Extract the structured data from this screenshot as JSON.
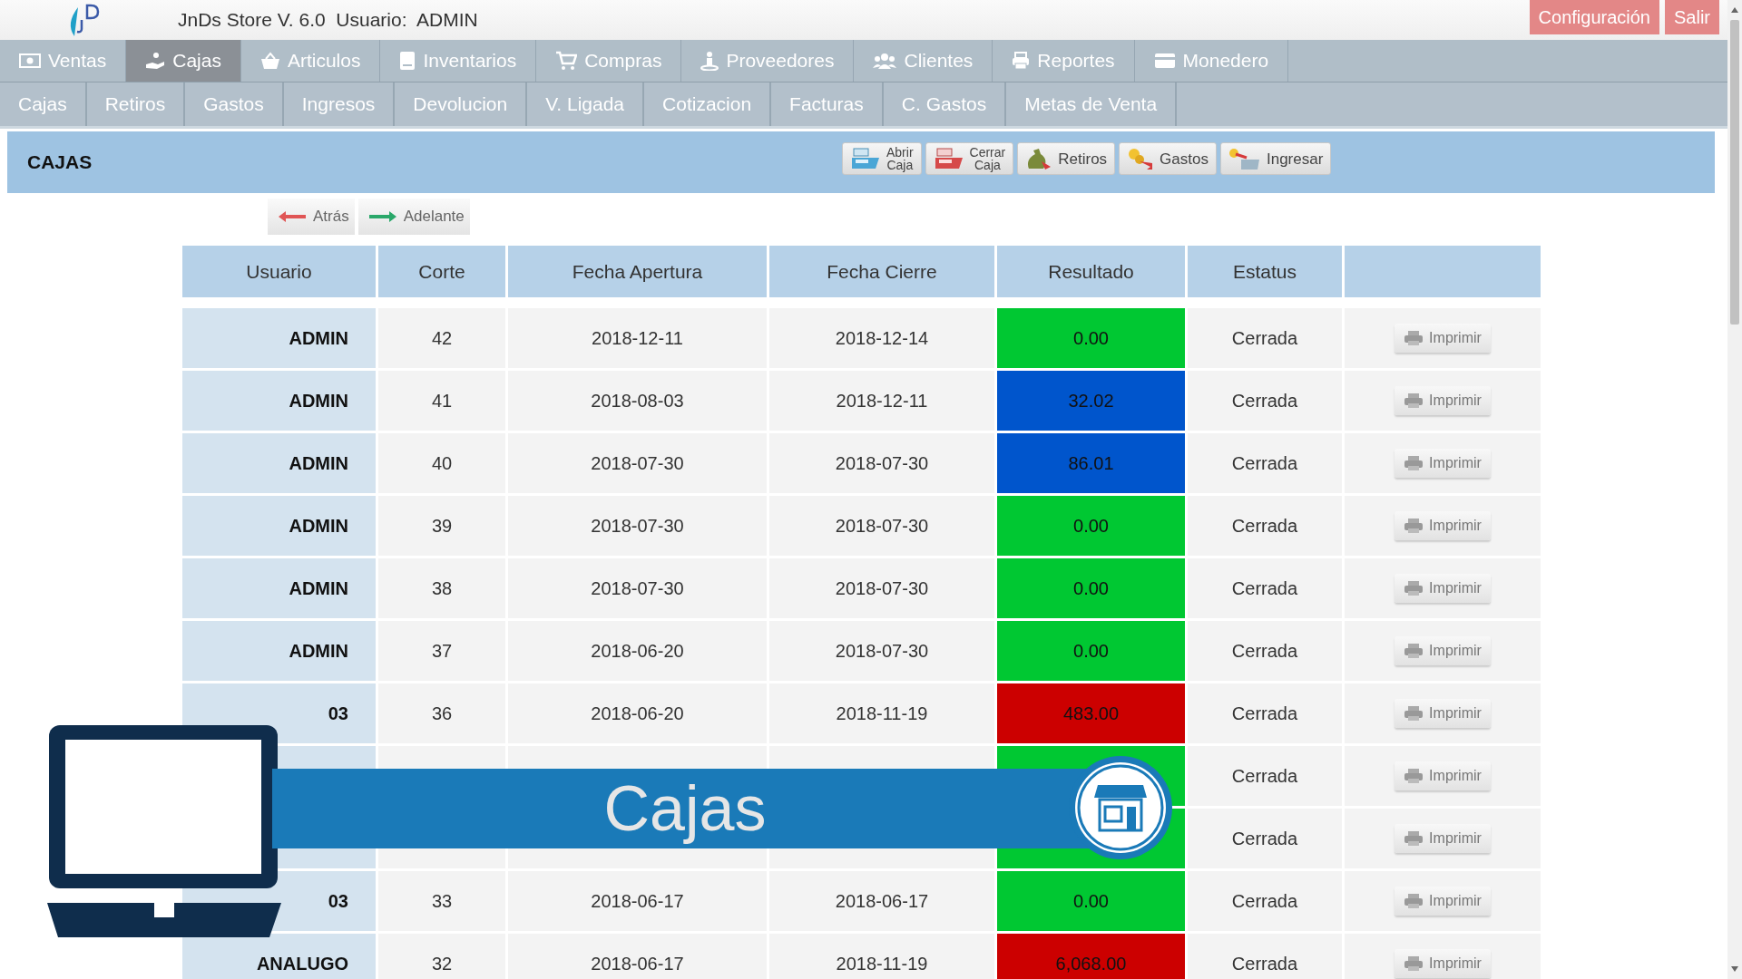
{
  "app": {
    "title": "JnDs Store V. 6.0",
    "user_label": "Usuario:",
    "user": "ADMIN",
    "actions": [
      "Configuración",
      "Salir"
    ]
  },
  "main_menu": [
    {
      "label": "Ventas",
      "selected": false
    },
    {
      "label": "Cajas",
      "selected": true
    },
    {
      "label": "Articulos",
      "selected": false
    },
    {
      "label": "Inventarios",
      "selected": false
    },
    {
      "label": "Compras",
      "selected": false
    },
    {
      "label": "Proveedores",
      "selected": false
    },
    {
      "label": "Clientes",
      "selected": false
    },
    {
      "label": "Reportes",
      "selected": false
    },
    {
      "label": "Monedero",
      "selected": false
    }
  ],
  "sub_menu": [
    "Cajas",
    "Retiros",
    "Gastos",
    "Ingresos",
    "Devolucion",
    "V. Ligada",
    "Cotizacion",
    "Facturas",
    "C. Gastos",
    "Metas de Venta"
  ],
  "panel": {
    "title": "CAJAS",
    "tools": [
      {
        "lines": [
          "Abrir",
          "Caja"
        ]
      },
      {
        "lines": [
          "Cerrar",
          "Caja"
        ]
      },
      {
        "lines": [
          "Retiros"
        ]
      },
      {
        "lines": [
          "Gastos"
        ]
      },
      {
        "lines": [
          "Ingresar"
        ]
      }
    ]
  },
  "nav": [
    "Atrás",
    "Adelante"
  ],
  "table": {
    "columns": [
      "Usuario",
      "Corte",
      "Fecha Apertura",
      "Fecha Cierre",
      "Resultado",
      "Estatus"
    ],
    "rows": [
      {
        "usuario": "ADMIN",
        "corte": "42",
        "apertura": "2018-12-11",
        "cierre": "2018-12-14",
        "resultado": "0.00",
        "color": "#00c832",
        "estatus": "Cerrada",
        "action": "Imprimir"
      },
      {
        "usuario": "ADMIN",
        "corte": "41",
        "apertura": "2018-08-03",
        "cierre": "2018-12-11",
        "resultado": "32.02",
        "color": "#0055cc",
        "estatus": "Cerrada",
        "action": "Imprimir"
      },
      {
        "usuario": "ADMIN",
        "corte": "40",
        "apertura": "2018-07-30",
        "cierre": "2018-07-30",
        "resultado": "86.01",
        "color": "#0055cc",
        "estatus": "Cerrada",
        "action": "Imprimir"
      },
      {
        "usuario": "ADMIN",
        "corte": "39",
        "apertura": "2018-07-30",
        "cierre": "2018-07-30",
        "resultado": "0.00",
        "color": "#00c832",
        "estatus": "Cerrada",
        "action": "Imprimir"
      },
      {
        "usuario": "ADMIN",
        "corte": "38",
        "apertura": "2018-07-30",
        "cierre": "2018-07-30",
        "resultado": "0.00",
        "color": "#00c832",
        "estatus": "Cerrada",
        "action": "Imprimir"
      },
      {
        "usuario": "ADMIN",
        "corte": "37",
        "apertura": "2018-06-20",
        "cierre": "2018-07-30",
        "resultado": "0.00",
        "color": "#00c832",
        "estatus": "Cerrada",
        "action": "Imprimir"
      },
      {
        "usuario": "03",
        "corte": "36",
        "apertura": "2018-06-20",
        "cierre": "2018-11-19",
        "resultado": "483.00",
        "color": "#cc0000",
        "estatus": "Cerrada",
        "action": "Imprimir"
      },
      {
        "color": "#00c832",
        "estatus": "Cerrada",
        "action": "Imprimir"
      },
      {
        "color": "#00c832",
        "estatus": "Cerrada",
        "action": "Imprimir"
      },
      {
        "usuario": "03",
        "corte": "33",
        "apertura": "2018-06-17",
        "cierre": "2018-06-17",
        "resultado": "0.00",
        "color": "#00c832",
        "estatus": "Cerrada",
        "action": "Imprimir"
      },
      {
        "usuario": "ANALUGO",
        "corte": "32",
        "apertura": "2018-06-17",
        "cierre": "2018-11-19",
        "resultado": "6,068.00",
        "color": "#cc0000",
        "estatus": "Cerrada",
        "action": "Imprimir"
      }
    ]
  },
  "overlay": {
    "title": "Cajas"
  }
}
